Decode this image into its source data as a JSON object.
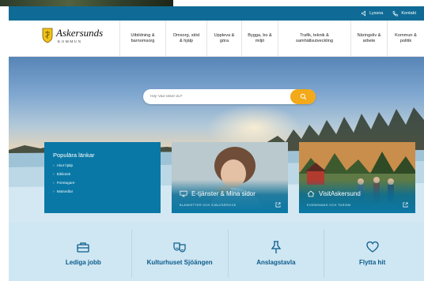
{
  "utility": {
    "read_label": "Lyssna",
    "contact_label": "Kontakt"
  },
  "logo": {
    "name": "Askersunds",
    "subtitle": "KOMMUN"
  },
  "nav": [
    {
      "line1": "Utbildning &",
      "line2": "barnomsorg"
    },
    {
      "line1": "Omsorg, stöd",
      "line2": "& hjälp"
    },
    {
      "line1": "Uppleva &",
      "line2": "göra"
    },
    {
      "line1": "Bygga, bo &",
      "line2": "miljö"
    },
    {
      "line1": "Trafik, teknik &",
      "line2": "samhällsutveckling"
    },
    {
      "line1": "Näringsliv &",
      "line2": "arbete"
    },
    {
      "line1": "Kommun &",
      "line2": "politik"
    }
  ],
  "search": {
    "placeholder": "Hej! Vad söker du?"
  },
  "popular": {
    "title": "Populära länkar",
    "links": [
      "Akut hjälp",
      "Bibliotek",
      "Företagare",
      "Matsedlar"
    ]
  },
  "cards": [
    {
      "title": "E-tjänster & Mina sidor",
      "subtitle": "BLANKETTER OCH SJÄLVSERVICE",
      "icon": "computer-icon"
    },
    {
      "title": "VisitAskersund",
      "subtitle": "EVENEMANG OCH TURISM",
      "icon": "house-icon"
    }
  ],
  "tiles": [
    {
      "label": "Lediga jobb",
      "icon": "briefcase-icon"
    },
    {
      "label": "Kulturhuset Sjöängen",
      "icon": "theater-masks-icon"
    },
    {
      "label": "Anslagstavla",
      "icon": "pushpin-icon"
    },
    {
      "label": "Flytta hit",
      "icon": "heart-icon"
    }
  ],
  "colors": {
    "primary": "#0a78a6",
    "utility_bar": "#0f6b95",
    "accent": "#f2a91a",
    "tile_text": "#0b5c8a",
    "band": "#cfe6f3"
  }
}
